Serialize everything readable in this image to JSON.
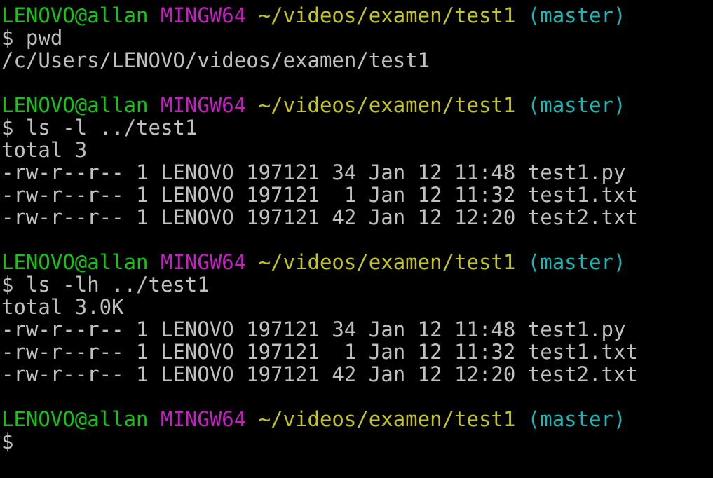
{
  "colors": {
    "background": "#000000",
    "user": "#13c613",
    "msystem": "#c31fc3",
    "path": "#c4c423",
    "branch": "#1ab7b7",
    "text": "#c0c0c0"
  },
  "blocks": [
    {
      "prompt": {
        "user": "LENOVO@allan",
        "msystem": "MINGW64",
        "path": "~/videos/examen/test1",
        "branch": "(master)"
      },
      "command": "$ pwd",
      "output": [
        "/c/Users/LENOVO/videos/examen/test1"
      ]
    },
    {
      "prompt": {
        "user": "LENOVO@allan",
        "msystem": "MINGW64",
        "path": "~/videos/examen/test1",
        "branch": "(master)"
      },
      "command": "$ ls -l ../test1",
      "output": [
        "total 3",
        "-rw-r--r-- 1 LENOVO 197121 34 Jan 12 11:48 test1.py",
        "-rw-r--r-- 1 LENOVO 197121  1 Jan 12 11:32 test1.txt",
        "-rw-r--r-- 1 LENOVO 197121 42 Jan 12 12:20 test2.txt"
      ]
    },
    {
      "prompt": {
        "user": "LENOVO@allan",
        "msystem": "MINGW64",
        "path": "~/videos/examen/test1",
        "branch": "(master)"
      },
      "command": "$ ls -lh ../test1",
      "output": [
        "total 3.0K",
        "-rw-r--r-- 1 LENOVO 197121 34 Jan 12 11:48 test1.py",
        "-rw-r--r-- 1 LENOVO 197121  1 Jan 12 11:32 test1.txt",
        "-rw-r--r-- 1 LENOVO 197121 42 Jan 12 12:20 test2.txt"
      ]
    },
    {
      "prompt": {
        "user": "LENOVO@allan",
        "msystem": "MINGW64",
        "path": "~/videos/examen/test1",
        "branch": "(master)"
      },
      "command": "$",
      "output": []
    }
  ]
}
